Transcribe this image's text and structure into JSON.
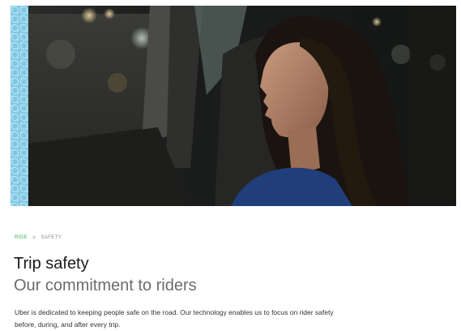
{
  "breadcrumb": {
    "parent": "Ride",
    "separator": ">",
    "current": "Safety"
  },
  "page": {
    "title": "Trip safety",
    "subtitle": "Our commitment to riders",
    "body": "Uber is dedicated to keeping people safe on the road. Our technology enables us to focus on rider safety before, during, and after every trip."
  },
  "colors": {
    "breadcrumb_link": "#3aa757",
    "pattern": "#7fc7e3"
  }
}
